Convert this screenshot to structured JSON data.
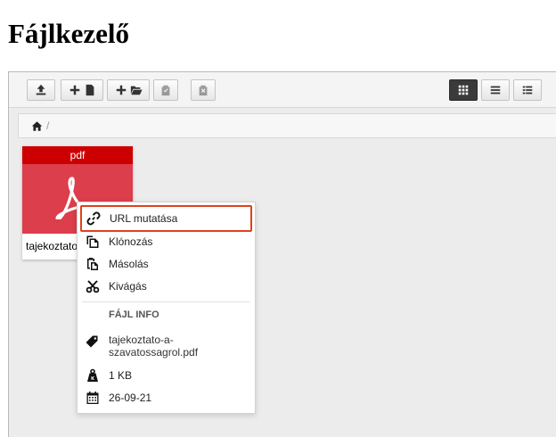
{
  "page": {
    "title": "Fájlkezelő"
  },
  "toolbar": {
    "buttons": [
      {
        "name": "upload-button",
        "icon": "upload-icon",
        "disabled": false
      },
      {
        "name": "new-file-button",
        "icon": "plus-file-icon",
        "disabled": false
      },
      {
        "name": "new-folder-button",
        "icon": "plus-folder-icon",
        "disabled": false
      },
      {
        "name": "paste-button",
        "icon": "clipboard-check-icon",
        "disabled": true
      },
      {
        "name": "clear-clipboard-button",
        "icon": "clipboard-x-icon",
        "disabled": true
      }
    ],
    "views": [
      {
        "name": "view-grid-button",
        "icon": "grid-icon",
        "active": true
      },
      {
        "name": "view-list-button",
        "icon": "list-icon",
        "active": false
      },
      {
        "name": "view-details-button",
        "icon": "details-list-icon",
        "active": false
      }
    ]
  },
  "breadcrumb": {
    "home_icon": "home-icon",
    "separator": "/"
  },
  "file": {
    "type_label": "pdf",
    "name": "tajekoztato",
    "icon": "acrobat-icon",
    "colors": {
      "type_bar": "#cc0000",
      "thumb": "#dc3e4b"
    }
  },
  "context_menu": {
    "items": [
      {
        "label": "URL mutatása",
        "icon": "link-icon"
      },
      {
        "label": "Klónozás",
        "icon": "copy-icon"
      },
      {
        "label": "Másolás",
        "icon": "paste-icon"
      },
      {
        "label": "Kivágás",
        "icon": "scissors-icon"
      }
    ],
    "info_header": "FÁJL INFO",
    "info": {
      "filename": "tajekoztato-a-szavatossagrol.pdf",
      "size": "1 KB",
      "date": "26-09-21"
    },
    "highlight_color": "#e0401c"
  }
}
